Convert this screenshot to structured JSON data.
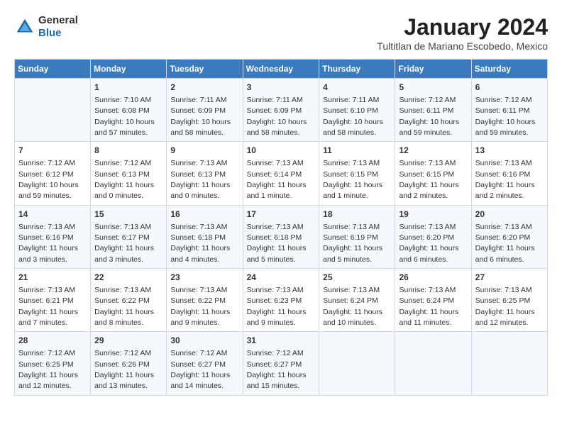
{
  "logo": {
    "general": "General",
    "blue": "Blue"
  },
  "title": "January 2024",
  "subtitle": "Tultitlan de Mariano Escobedo, Mexico",
  "days_of_week": [
    "Sunday",
    "Monday",
    "Tuesday",
    "Wednesday",
    "Thursday",
    "Friday",
    "Saturday"
  ],
  "weeks": [
    [
      {
        "day": "",
        "info": ""
      },
      {
        "day": "1",
        "info": "Sunrise: 7:10 AM\nSunset: 6:08 PM\nDaylight: 10 hours\nand 57 minutes."
      },
      {
        "day": "2",
        "info": "Sunrise: 7:11 AM\nSunset: 6:09 PM\nDaylight: 10 hours\nand 58 minutes."
      },
      {
        "day": "3",
        "info": "Sunrise: 7:11 AM\nSunset: 6:09 PM\nDaylight: 10 hours\nand 58 minutes."
      },
      {
        "day": "4",
        "info": "Sunrise: 7:11 AM\nSunset: 6:10 PM\nDaylight: 10 hours\nand 58 minutes."
      },
      {
        "day": "5",
        "info": "Sunrise: 7:12 AM\nSunset: 6:11 PM\nDaylight: 10 hours\nand 59 minutes."
      },
      {
        "day": "6",
        "info": "Sunrise: 7:12 AM\nSunset: 6:11 PM\nDaylight: 10 hours\nand 59 minutes."
      }
    ],
    [
      {
        "day": "7",
        "info": "Sunrise: 7:12 AM\nSunset: 6:12 PM\nDaylight: 10 hours\nand 59 minutes."
      },
      {
        "day": "8",
        "info": "Sunrise: 7:12 AM\nSunset: 6:13 PM\nDaylight: 11 hours\nand 0 minutes."
      },
      {
        "day": "9",
        "info": "Sunrise: 7:13 AM\nSunset: 6:13 PM\nDaylight: 11 hours\nand 0 minutes."
      },
      {
        "day": "10",
        "info": "Sunrise: 7:13 AM\nSunset: 6:14 PM\nDaylight: 11 hours\nand 1 minute."
      },
      {
        "day": "11",
        "info": "Sunrise: 7:13 AM\nSunset: 6:15 PM\nDaylight: 11 hours\nand 1 minute."
      },
      {
        "day": "12",
        "info": "Sunrise: 7:13 AM\nSunset: 6:15 PM\nDaylight: 11 hours\nand 2 minutes."
      },
      {
        "day": "13",
        "info": "Sunrise: 7:13 AM\nSunset: 6:16 PM\nDaylight: 11 hours\nand 2 minutes."
      }
    ],
    [
      {
        "day": "14",
        "info": "Sunrise: 7:13 AM\nSunset: 6:16 PM\nDaylight: 11 hours\nand 3 minutes."
      },
      {
        "day": "15",
        "info": "Sunrise: 7:13 AM\nSunset: 6:17 PM\nDaylight: 11 hours\nand 3 minutes."
      },
      {
        "day": "16",
        "info": "Sunrise: 7:13 AM\nSunset: 6:18 PM\nDaylight: 11 hours\nand 4 minutes."
      },
      {
        "day": "17",
        "info": "Sunrise: 7:13 AM\nSunset: 6:18 PM\nDaylight: 11 hours\nand 5 minutes."
      },
      {
        "day": "18",
        "info": "Sunrise: 7:13 AM\nSunset: 6:19 PM\nDaylight: 11 hours\nand 5 minutes."
      },
      {
        "day": "19",
        "info": "Sunrise: 7:13 AM\nSunset: 6:20 PM\nDaylight: 11 hours\nand 6 minutes."
      },
      {
        "day": "20",
        "info": "Sunrise: 7:13 AM\nSunset: 6:20 PM\nDaylight: 11 hours\nand 6 minutes."
      }
    ],
    [
      {
        "day": "21",
        "info": "Sunrise: 7:13 AM\nSunset: 6:21 PM\nDaylight: 11 hours\nand 7 minutes."
      },
      {
        "day": "22",
        "info": "Sunrise: 7:13 AM\nSunset: 6:22 PM\nDaylight: 11 hours\nand 8 minutes."
      },
      {
        "day": "23",
        "info": "Sunrise: 7:13 AM\nSunset: 6:22 PM\nDaylight: 11 hours\nand 9 minutes."
      },
      {
        "day": "24",
        "info": "Sunrise: 7:13 AM\nSunset: 6:23 PM\nDaylight: 11 hours\nand 9 minutes."
      },
      {
        "day": "25",
        "info": "Sunrise: 7:13 AM\nSunset: 6:24 PM\nDaylight: 11 hours\nand 10 minutes."
      },
      {
        "day": "26",
        "info": "Sunrise: 7:13 AM\nSunset: 6:24 PM\nDaylight: 11 hours\nand 11 minutes."
      },
      {
        "day": "27",
        "info": "Sunrise: 7:13 AM\nSunset: 6:25 PM\nDaylight: 11 hours\nand 12 minutes."
      }
    ],
    [
      {
        "day": "28",
        "info": "Sunrise: 7:12 AM\nSunset: 6:25 PM\nDaylight: 11 hours\nand 12 minutes."
      },
      {
        "day": "29",
        "info": "Sunrise: 7:12 AM\nSunset: 6:26 PM\nDaylight: 11 hours\nand 13 minutes."
      },
      {
        "day": "30",
        "info": "Sunrise: 7:12 AM\nSunset: 6:27 PM\nDaylight: 11 hours\nand 14 minutes."
      },
      {
        "day": "31",
        "info": "Sunrise: 7:12 AM\nSunset: 6:27 PM\nDaylight: 11 hours\nand 15 minutes."
      },
      {
        "day": "",
        "info": ""
      },
      {
        "day": "",
        "info": ""
      },
      {
        "day": "",
        "info": ""
      }
    ]
  ]
}
